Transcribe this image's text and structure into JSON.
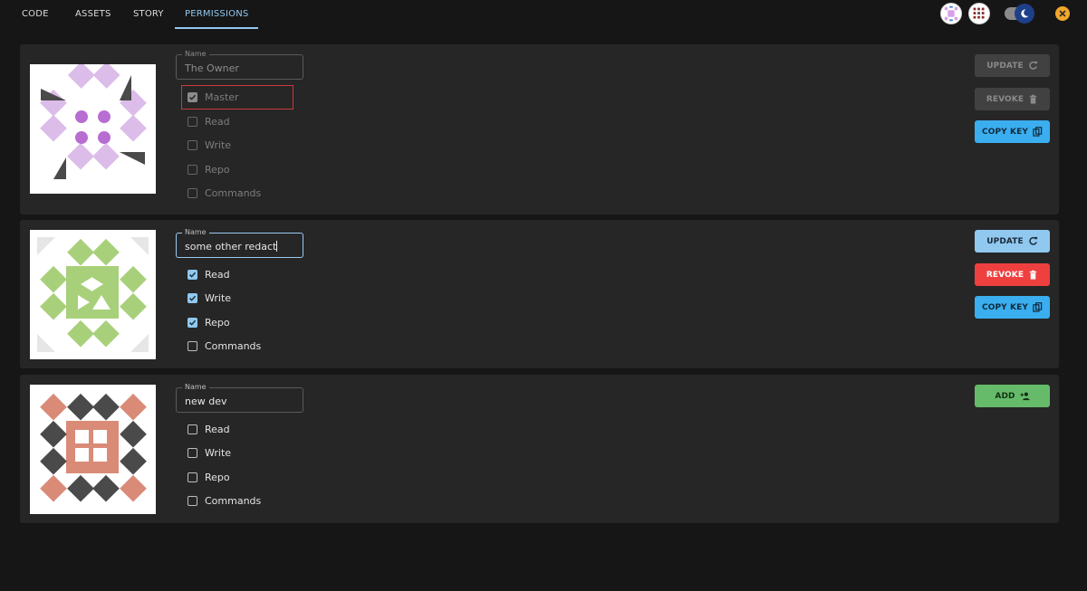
{
  "tabs": [
    {
      "label": "CODE"
    },
    {
      "label": "ASSETS"
    },
    {
      "label": "STORY"
    },
    {
      "label": "PERMISSIONS"
    }
  ],
  "active_tab": "PERMISSIONS",
  "theme_toggle": {
    "dark_mode": true
  },
  "colors": {
    "accent": "#90c8f0",
    "danger": "#ef4040",
    "copy": "#3aaeef",
    "add": "#66bb6a",
    "card": "#262626",
    "background": "#161616"
  },
  "entries": [
    {
      "name_label": "Name",
      "name_value": "The Owner",
      "state": "disabled",
      "permissions": [
        {
          "label": "Master",
          "checked": true
        },
        {
          "label": "Read",
          "checked": false
        },
        {
          "label": "Write",
          "checked": false
        },
        {
          "label": "Repo",
          "checked": false
        },
        {
          "label": "Commands",
          "checked": false
        }
      ],
      "buttons": {
        "update": "UPDATE",
        "revoke": "REVOKE",
        "copy_key": "COPY KEY"
      }
    },
    {
      "name_label": "Name",
      "name_value": "some other redact",
      "state": "editing",
      "permissions": [
        {
          "label": "Read",
          "checked": true
        },
        {
          "label": "Write",
          "checked": true
        },
        {
          "label": "Repo",
          "checked": true
        },
        {
          "label": "Commands",
          "checked": false
        }
      ],
      "buttons": {
        "update": "UPDATE",
        "revoke": "REVOKE",
        "copy_key": "COPY KEY"
      }
    },
    {
      "name_label": "Name",
      "name_value": "new dev",
      "state": "new",
      "permissions": [
        {
          "label": "Read",
          "checked": false
        },
        {
          "label": "Write",
          "checked": false
        },
        {
          "label": "Repo",
          "checked": false
        },
        {
          "label": "Commands",
          "checked": false
        }
      ],
      "buttons": {
        "add": "ADD"
      }
    }
  ],
  "icons": {
    "update": "refresh-icon",
    "revoke": "trash-icon",
    "copy_key": "copy-icon",
    "add": "add-user-icon",
    "close": "close-icon",
    "theme": "moon-icon"
  }
}
